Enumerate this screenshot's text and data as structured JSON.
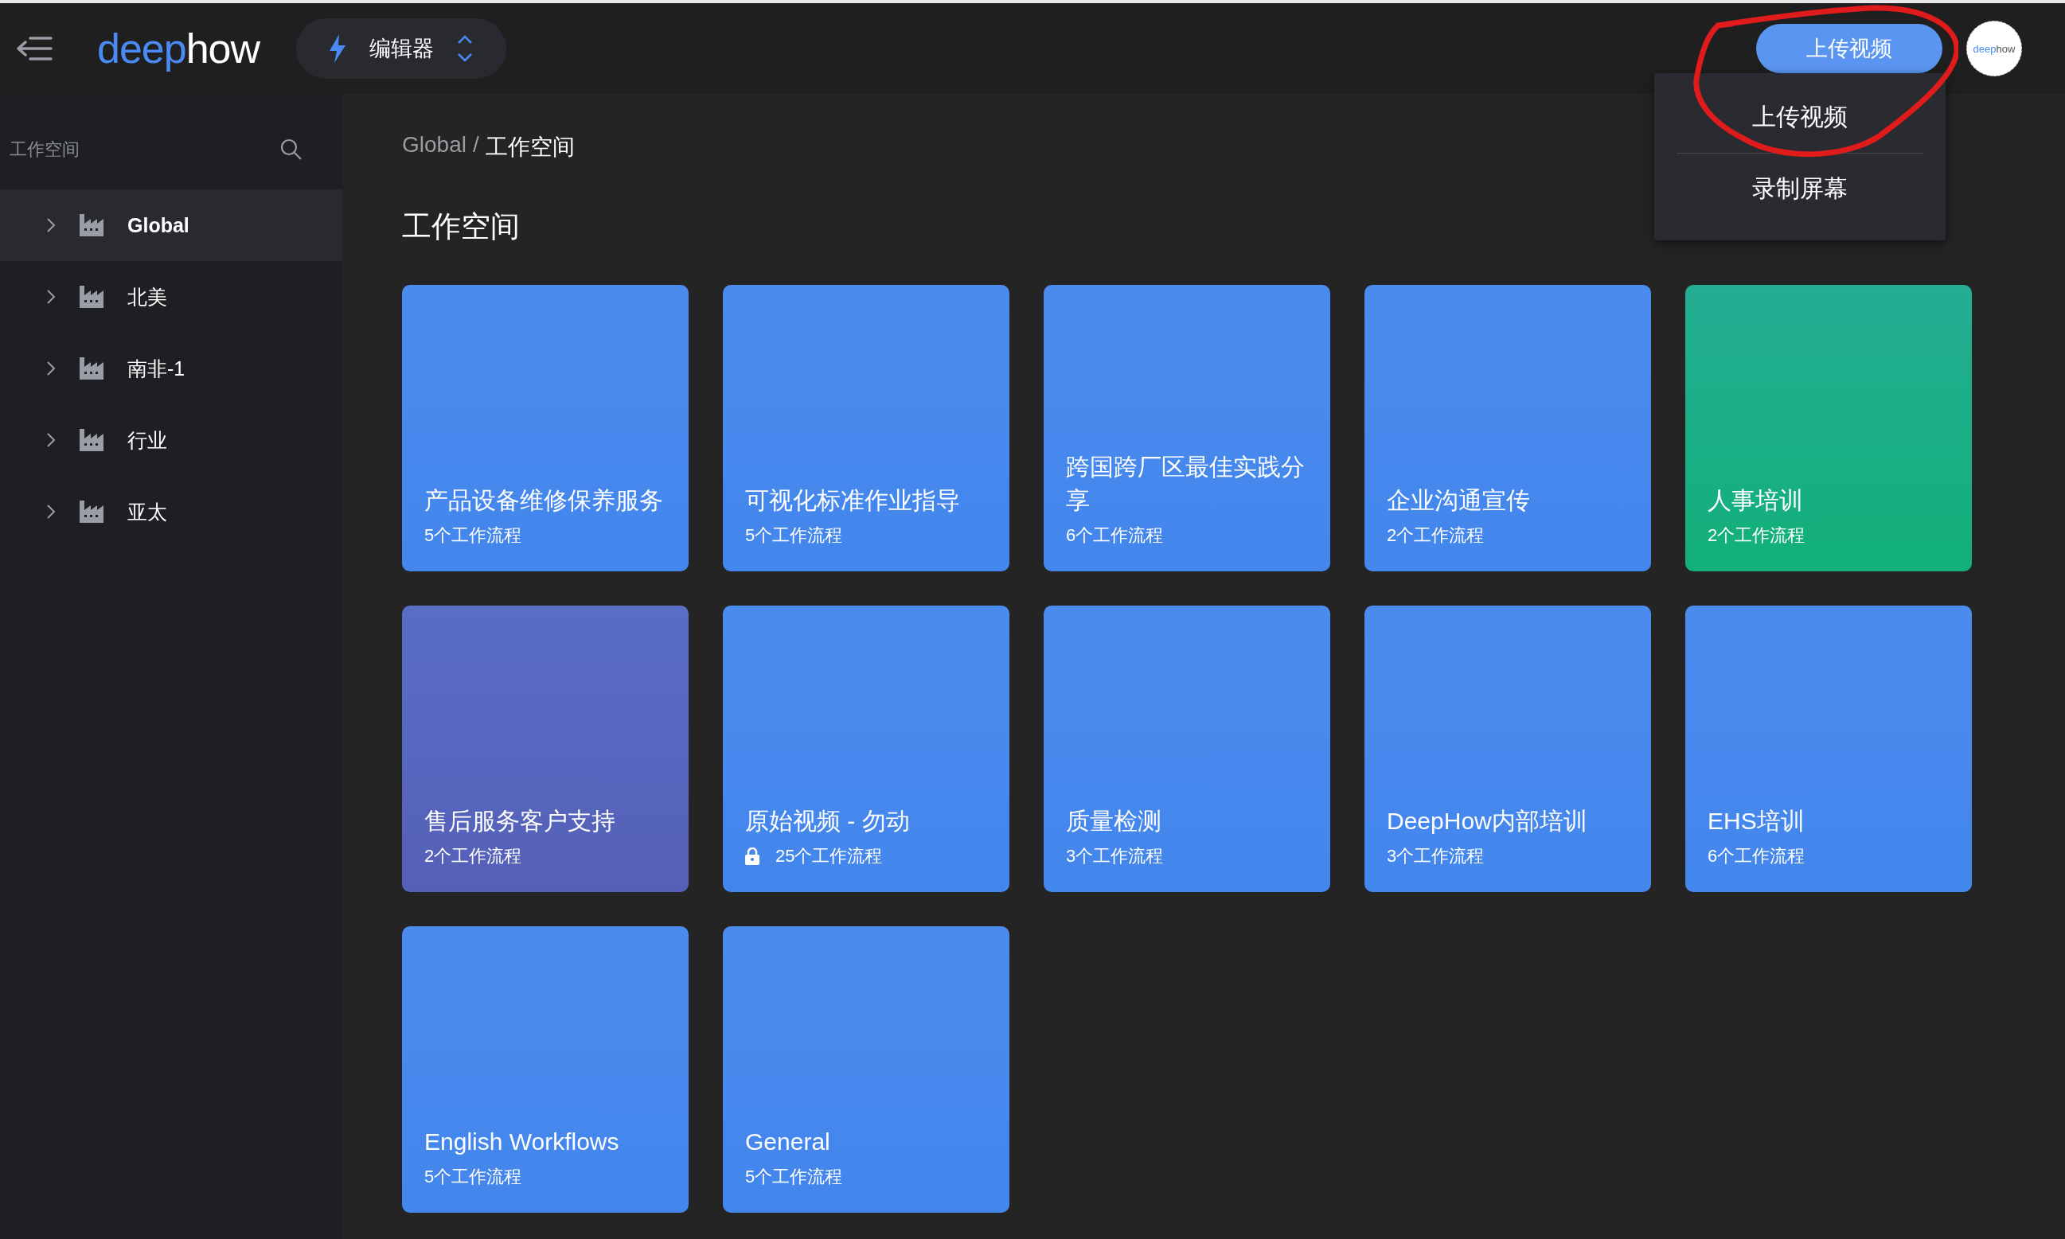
{
  "top_bar": {
    "brand": [
      "deep",
      "how"
    ],
    "mode_switch": {
      "label": "编辑器"
    },
    "upload_button": "上传视频",
    "avatar_brand": [
      "deep",
      "how"
    ]
  },
  "upload_menu": {
    "items": [
      {
        "label": "上传视频"
      },
      {
        "label": "录制屏幕"
      }
    ]
  },
  "sidebar": {
    "title": "工作空间",
    "items": [
      {
        "label": "Global",
        "selected": true
      },
      {
        "label": "北美",
        "selected": false
      },
      {
        "label": "南非-1",
        "selected": false
      },
      {
        "label": "行业",
        "selected": false
      },
      {
        "label": "亚太",
        "selected": false
      }
    ]
  },
  "breadcrumb": {
    "root": "Global",
    "separator": "/",
    "current": "工作空间"
  },
  "heading": "工作空间",
  "workspaces": [
    {
      "title": "产品设备维修保养服务",
      "count": "5个工作流程",
      "locked": false,
      "color": "#4386ec"
    },
    {
      "title": "可视化标准作业指导",
      "count": "5个工作流程",
      "locked": false,
      "color": "#4386ec"
    },
    {
      "title": "跨国跨厂区最佳实践分享",
      "count": "6个工作流程",
      "locked": false,
      "color": "#4386ec"
    },
    {
      "title": "企业沟通宣传",
      "count": "2个工作流程",
      "locked": false,
      "color": "#4386ec"
    },
    {
      "title": "人事培训",
      "count": "2个工作流程",
      "locked": false,
      "color": "#12b07a"
    },
    {
      "title": "售后服务客户支持",
      "count": "2个工作流程",
      "locked": false,
      "color": "#5560b8"
    },
    {
      "title": "原始视频 - 勿动",
      "count": "25个工作流程",
      "locked": true,
      "color": "#4386ec"
    },
    {
      "title": "质量检测",
      "count": "3个工作流程",
      "locked": false,
      "color": "#4386ec"
    },
    {
      "title": "DeepHow内部培训",
      "count": "3个工作流程",
      "locked": false,
      "color": "#4386ec"
    },
    {
      "title": "EHS培训",
      "count": "6个工作流程",
      "locked": false,
      "color": "#4386ec"
    },
    {
      "title": "English Workflows",
      "count": "5个工作流程",
      "locked": false,
      "color": "#4386ec"
    },
    {
      "title": "General",
      "count": "5个工作流程",
      "locked": false,
      "color": "#4386ec"
    }
  ]
}
